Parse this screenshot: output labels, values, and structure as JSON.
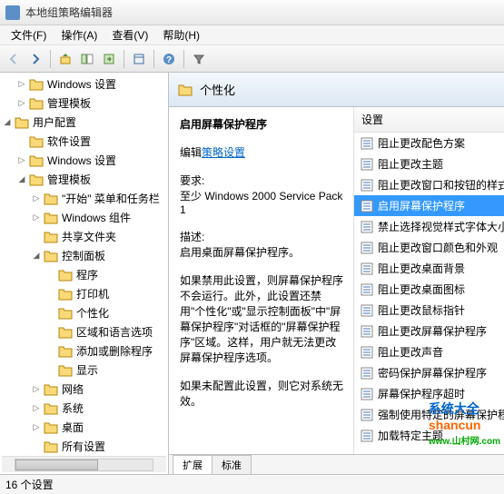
{
  "titlebar": {
    "title": "本地组策略编辑器"
  },
  "menubar": {
    "items": [
      {
        "label": "文件(F)"
      },
      {
        "label": "操作(A)"
      },
      {
        "label": "查看(V)"
      },
      {
        "label": "帮助(H)"
      }
    ]
  },
  "tree": {
    "items": [
      {
        "label": "Windows 设置",
        "indent": 1,
        "toggle": "▷"
      },
      {
        "label": "管理模板",
        "indent": 1,
        "toggle": "▷"
      },
      {
        "label": "用户配置",
        "indent": 0,
        "toggle": "◢"
      },
      {
        "label": "软件设置",
        "indent": 1,
        "toggle": ""
      },
      {
        "label": "Windows 设置",
        "indent": 1,
        "toggle": "▷"
      },
      {
        "label": "管理模板",
        "indent": 1,
        "toggle": "◢"
      },
      {
        "label": "\"开始\" 菜单和任务栏",
        "indent": 2,
        "toggle": "▷"
      },
      {
        "label": "Windows 组件",
        "indent": 2,
        "toggle": "▷"
      },
      {
        "label": "共享文件夹",
        "indent": 2,
        "toggle": ""
      },
      {
        "label": "控制面板",
        "indent": 2,
        "toggle": "◢"
      },
      {
        "label": "程序",
        "indent": 3,
        "toggle": ""
      },
      {
        "label": "打印机",
        "indent": 3,
        "toggle": ""
      },
      {
        "label": "个性化",
        "indent": 3,
        "toggle": ""
      },
      {
        "label": "区域和语言选项",
        "indent": 3,
        "toggle": ""
      },
      {
        "label": "添加或删除程序",
        "indent": 3,
        "toggle": ""
      },
      {
        "label": "显示",
        "indent": 3,
        "toggle": ""
      },
      {
        "label": "网络",
        "indent": 2,
        "toggle": "▷"
      },
      {
        "label": "系统",
        "indent": 2,
        "toggle": "▷"
      },
      {
        "label": "桌面",
        "indent": 2,
        "toggle": "▷"
      },
      {
        "label": "所有设置",
        "indent": 2,
        "toggle": ""
      }
    ]
  },
  "content": {
    "header": "个性化",
    "detail": {
      "title": "启用屏幕保护程序",
      "edit_label": "编辑",
      "policy_link": "策略设置",
      "req_label": "要求:",
      "req_text": "至少 Windows 2000 Service Pack 1",
      "desc_label": "描述:",
      "desc_text": "启用桌面屏幕保护程序。",
      "para1": "如果禁用此设置，则屏幕保护程序不会运行。此外，此设置还禁用\"个性化\"或\"显示控制面板\"中\"屏幕保护程序\"对话框的\"屏幕保护程序\"区域。这样，用户就无法更改屏幕保护程序选项。",
      "para2": "如果未配置此设置，则它对系统无效。"
    },
    "list": {
      "header": "设置",
      "items": [
        {
          "label": "阻止更改配色方案",
          "selected": false
        },
        {
          "label": "阻止更改主题",
          "selected": false
        },
        {
          "label": "阻止更改窗口和按钮的样式",
          "selected": false
        },
        {
          "label": "启用屏幕保护程序",
          "selected": true
        },
        {
          "label": "禁止选择视觉样式字体大小",
          "selected": false
        },
        {
          "label": "阻止更改窗口颜色和外观",
          "selected": false
        },
        {
          "label": "阻止更改桌面背景",
          "selected": false
        },
        {
          "label": "阻止更改桌面图标",
          "selected": false
        },
        {
          "label": "阻止更改鼠标指针",
          "selected": false
        },
        {
          "label": "阻止更改屏幕保护程序",
          "selected": false
        },
        {
          "label": "阻止更改声音",
          "selected": false
        },
        {
          "label": "密码保护屏幕保护程序",
          "selected": false
        },
        {
          "label": "屏幕保护程序超时",
          "selected": false
        },
        {
          "label": "强制使用特定的屏幕保护程序",
          "selected": false
        },
        {
          "label": "加载特定主题",
          "selected": false
        }
      ]
    },
    "tabs": [
      {
        "label": "扩展",
        "active": true
      },
      {
        "label": "标准",
        "active": false
      }
    ]
  },
  "statusbar": {
    "text": "16 个设置"
  },
  "watermark": {
    "line1": "系统大全",
    "line2": "shancun",
    "line3": "www.山村网.com"
  }
}
